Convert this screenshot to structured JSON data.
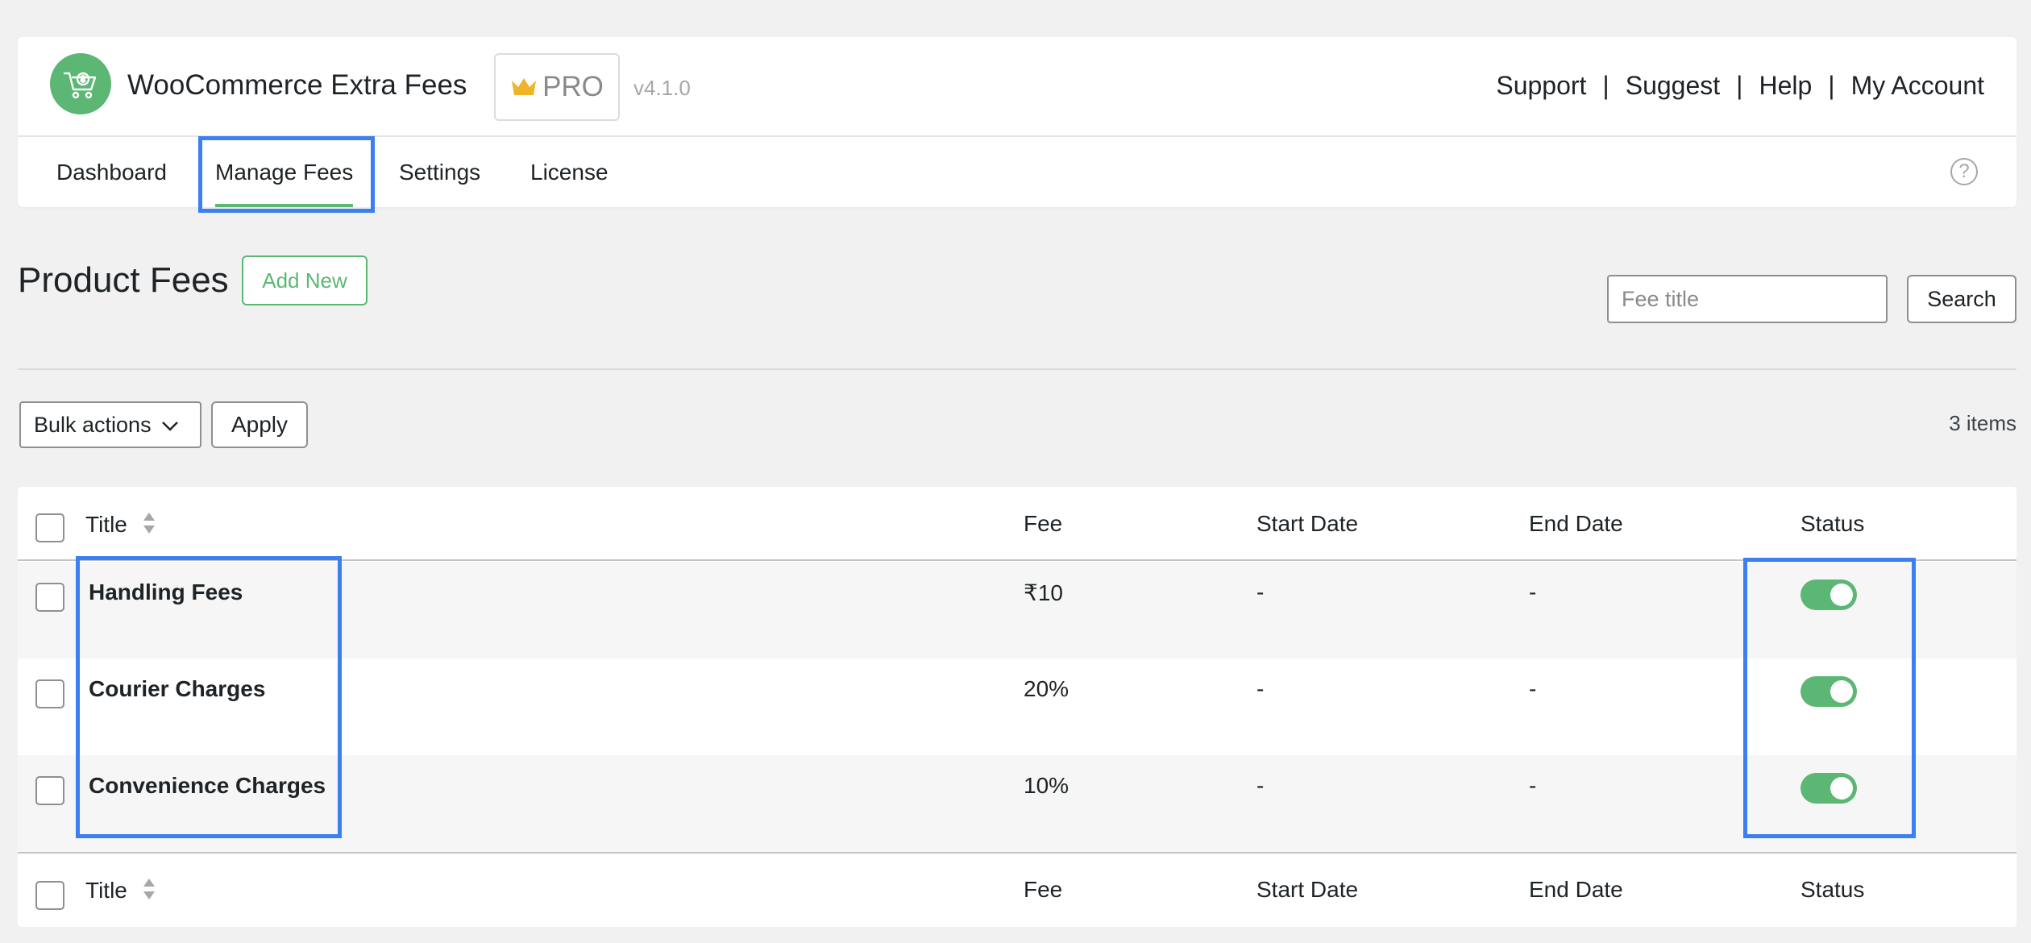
{
  "header": {
    "app_title": "WooCommerce Extra Fees",
    "badge": "PRO",
    "version": "v4.1.0",
    "links": [
      "Support",
      "Suggest",
      "Help",
      "My Account"
    ],
    "separator": "|"
  },
  "nav": {
    "tabs": [
      {
        "label": "Dashboard",
        "active": false
      },
      {
        "label": "Manage Fees",
        "active": true
      },
      {
        "label": "Settings",
        "active": false
      },
      {
        "label": "License",
        "active": false
      }
    ],
    "help_icon": "question-circle-icon"
  },
  "page": {
    "title": "Product Fees",
    "add_new_label": "Add New",
    "search_placeholder": "Fee title",
    "search_label": "Search"
  },
  "bulk": {
    "select_value": "Bulk actions",
    "apply_label": "Apply",
    "item_count": "3 items"
  },
  "table": {
    "columns": [
      "Title",
      "Fee",
      "Start Date",
      "End Date",
      "Status"
    ],
    "rows": [
      {
        "title": "Handling Fees",
        "fee": "₹10",
        "start": "-",
        "end": "-",
        "status": true
      },
      {
        "title": "Courier Charges",
        "fee": "20%",
        "start": "-",
        "end": "-",
        "status": true
      },
      {
        "title": "Convenience Charges",
        "fee": "10%",
        "start": "-",
        "end": "-",
        "status": true
      }
    ]
  },
  "colors": {
    "accent_green": "#5cb774",
    "highlight_blue": "#3b7ff0",
    "crown_gold": "#f0b429"
  }
}
